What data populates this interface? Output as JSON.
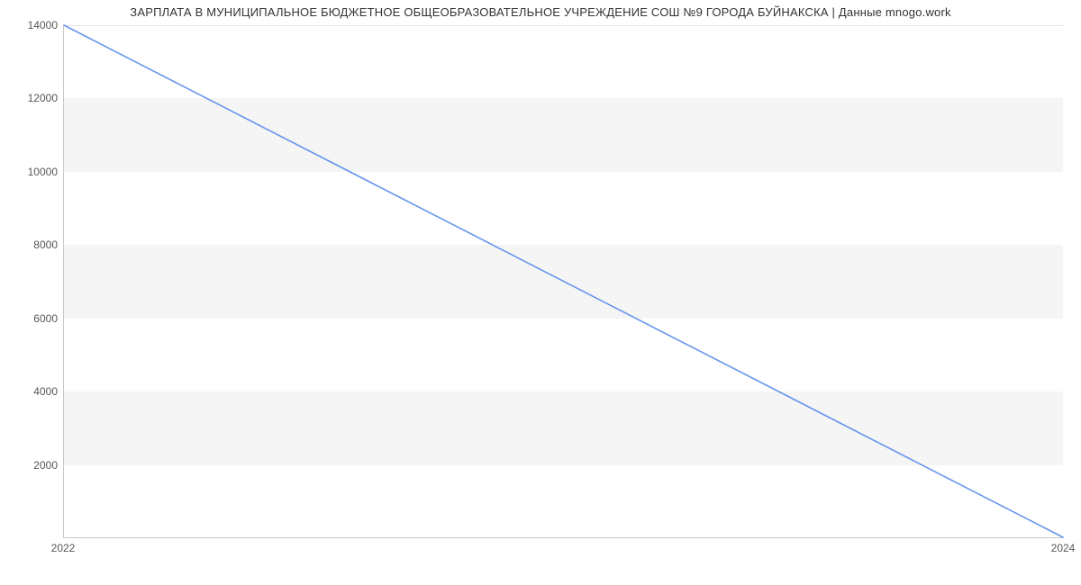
{
  "chart_data": {
    "type": "line",
    "title": "ЗАРПЛАТА В МУНИЦИПАЛЬНОЕ БЮДЖЕТНОЕ ОБЩЕОБРАЗОВАТЕЛЬНОЕ УЧРЕЖДЕНИЕ СОШ №9 ГОРОДА БУЙНАКСКА | Данные mnogo.work",
    "x": [
      2022,
      2024
    ],
    "values": [
      14000,
      0
    ],
    "xlabel": "",
    "ylabel": "",
    "xlim": [
      2022,
      2024
    ],
    "ylim": [
      0,
      14000
    ],
    "y_ticks": [
      2000,
      4000,
      6000,
      8000,
      10000,
      12000,
      14000
    ],
    "x_ticks": [
      2022,
      2024
    ],
    "line_color": "#6495ed"
  }
}
